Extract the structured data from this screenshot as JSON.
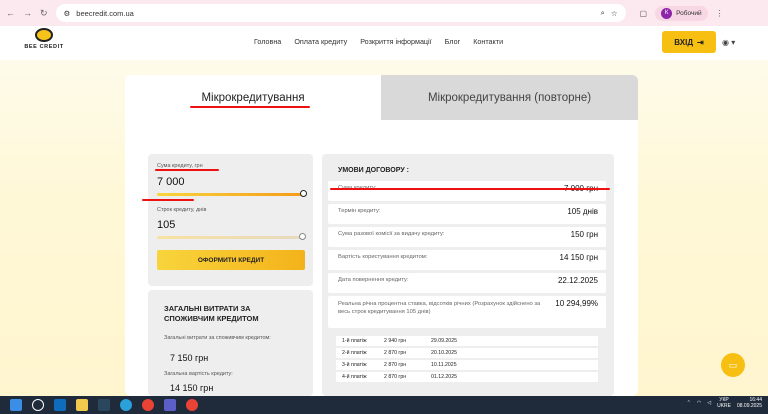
{
  "browser": {
    "url": "beecredit.com.ua",
    "profile_initial": "К",
    "profile_name": "Робочий"
  },
  "site": {
    "logo_text": "BEE CREDIT",
    "menu": [
      "Головна",
      "Оплата кредиту",
      "Розкриття інформації",
      "Блог",
      "Контакти"
    ],
    "login_label": "ВХІД"
  },
  "tabs": {
    "active": "Мікрокредитування",
    "inactive": "Мікрокредитування (повторне)"
  },
  "calculator": {
    "amount_label": "Сума кредиту, грн",
    "amount_value": "7 000",
    "amount_fill": 1.0,
    "term_label": "Строк кредиту, днів",
    "term_value": "105",
    "term_fill": 1.0,
    "button_label": "ОФОРМИТИ КРЕДИТ"
  },
  "costs": {
    "title": "ЗАГАЛЬНІ ВИТРАТИ ЗА СПОЖИВЧИМ КРЕДИТОМ",
    "expenses_label": "Загальні витрати за споживчим кредитом:",
    "expenses_value": "7 150 грн",
    "total_label": "Загальна вартість кредиту:",
    "total_value": "14 150 грн"
  },
  "terms": {
    "title": "УМОВИ ДОГОВОРУ :",
    "rows": [
      {
        "label": "Сума кредиту:",
        "value": "7 000 грн"
      },
      {
        "label": "Термін кредиту:",
        "value": "105 днів"
      },
      {
        "label": "Сума разової комісії за видачу кредиту:",
        "value": "150 грн"
      },
      {
        "label": "Вартість користування кредитом:",
        "value": "14 150 грн"
      },
      {
        "label": "Дата повернення кредиту:",
        "value": "22.12.2025"
      },
      {
        "label": "Реальна річна процентна ставка, відсотків річних (Розрахунок здійснено за весь строк кредитування 105 днів)",
        "value": "10 294,99%"
      }
    ],
    "schedule": [
      {
        "n": "1-й платіж",
        "amount": "2 940 грн",
        "date": "29.09.2025"
      },
      {
        "n": "2-й платіж",
        "amount": "2 870 грн",
        "date": "20.10.2025"
      },
      {
        "n": "3-й платіж",
        "amount": "2 870 грн",
        "date": "10.11.2025"
      },
      {
        "n": "4-й платіж",
        "amount": "2 870 грн",
        "date": "01.12.2025"
      }
    ]
  },
  "taskbar": {
    "lang_top": "УКР",
    "lang_bottom": "UKRE",
    "time": "16:44",
    "date": "08.09.2025"
  },
  "colors": {
    "accent": "#f6bf12",
    "annotation_red": "#e11111"
  }
}
